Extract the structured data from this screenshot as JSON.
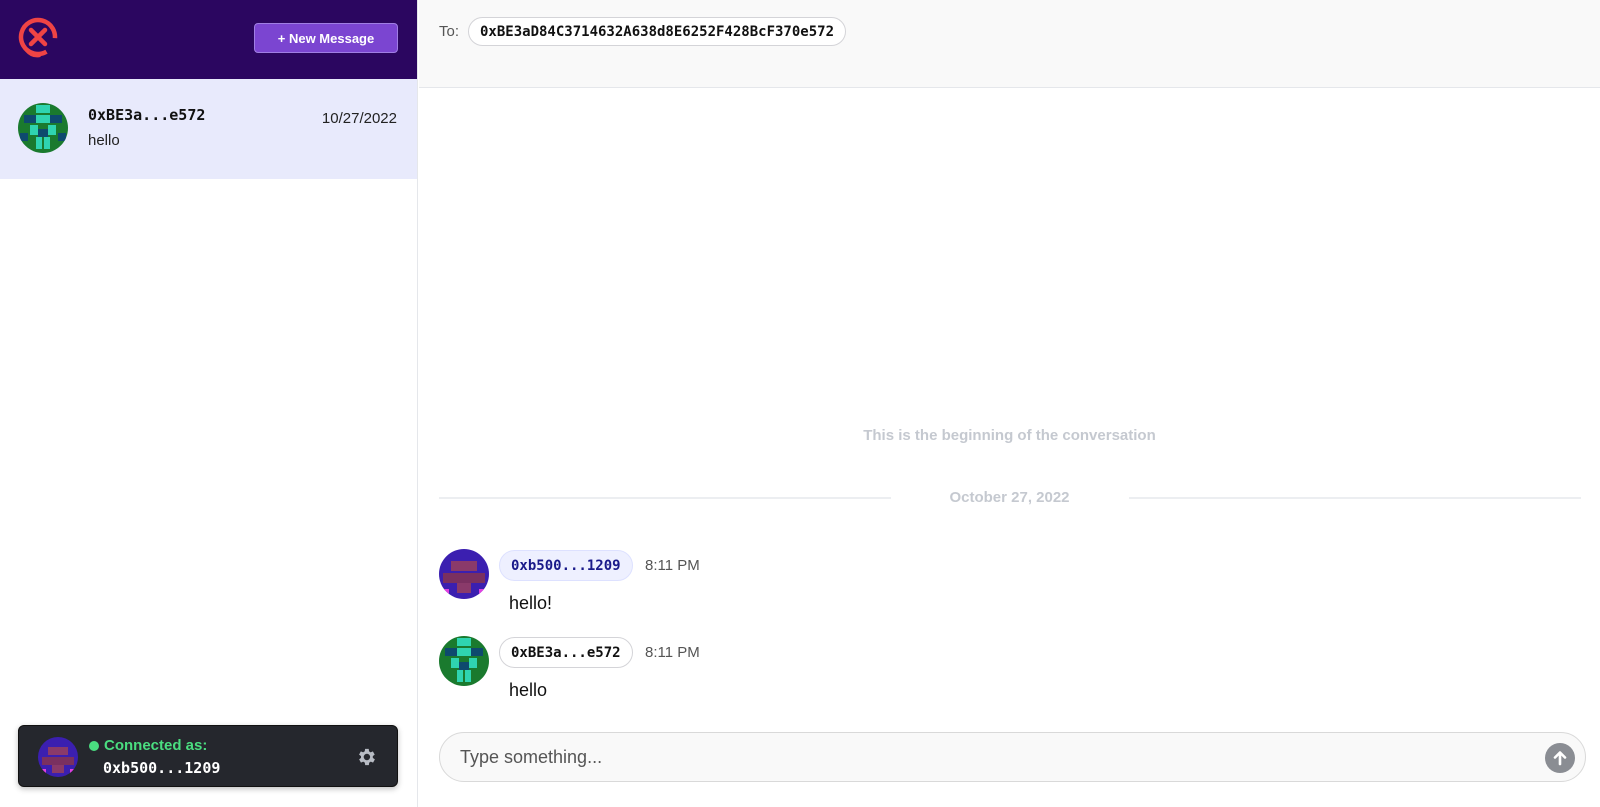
{
  "sidebar": {
    "new_message_label": "+ New Message",
    "conversations": [
      {
        "address": "0xBE3a...e572",
        "preview": "hello",
        "date": "10/27/2022"
      }
    ],
    "connected": {
      "label": "Connected as:",
      "address": "0xb500...1209",
      "status_color": "#4ade80"
    }
  },
  "header": {
    "to_label": "To:",
    "recipient": "0xBE3aD84C3714632A638d8E6252F428BcF370e572"
  },
  "conversation": {
    "beginning_text": "This is the beginning of the conversation",
    "date_divider": "October 27, 2022",
    "messages": [
      {
        "sender": "0xb500...1209",
        "time": "8:11 PM",
        "text": "hello!"
      },
      {
        "sender": "0xBE3a...e572",
        "time": "8:11 PM",
        "text": "hello"
      }
    ]
  },
  "composer": {
    "placeholder": "Type something..."
  },
  "colors": {
    "header_bg": "#2b0660",
    "accent": "#7b45d1",
    "selected_conv_bg": "#e8eafc",
    "logo_red": "#ef4444"
  },
  "icons": [
    "xmtp-logo-icon",
    "gear-icon",
    "send-arrow-icon"
  ]
}
